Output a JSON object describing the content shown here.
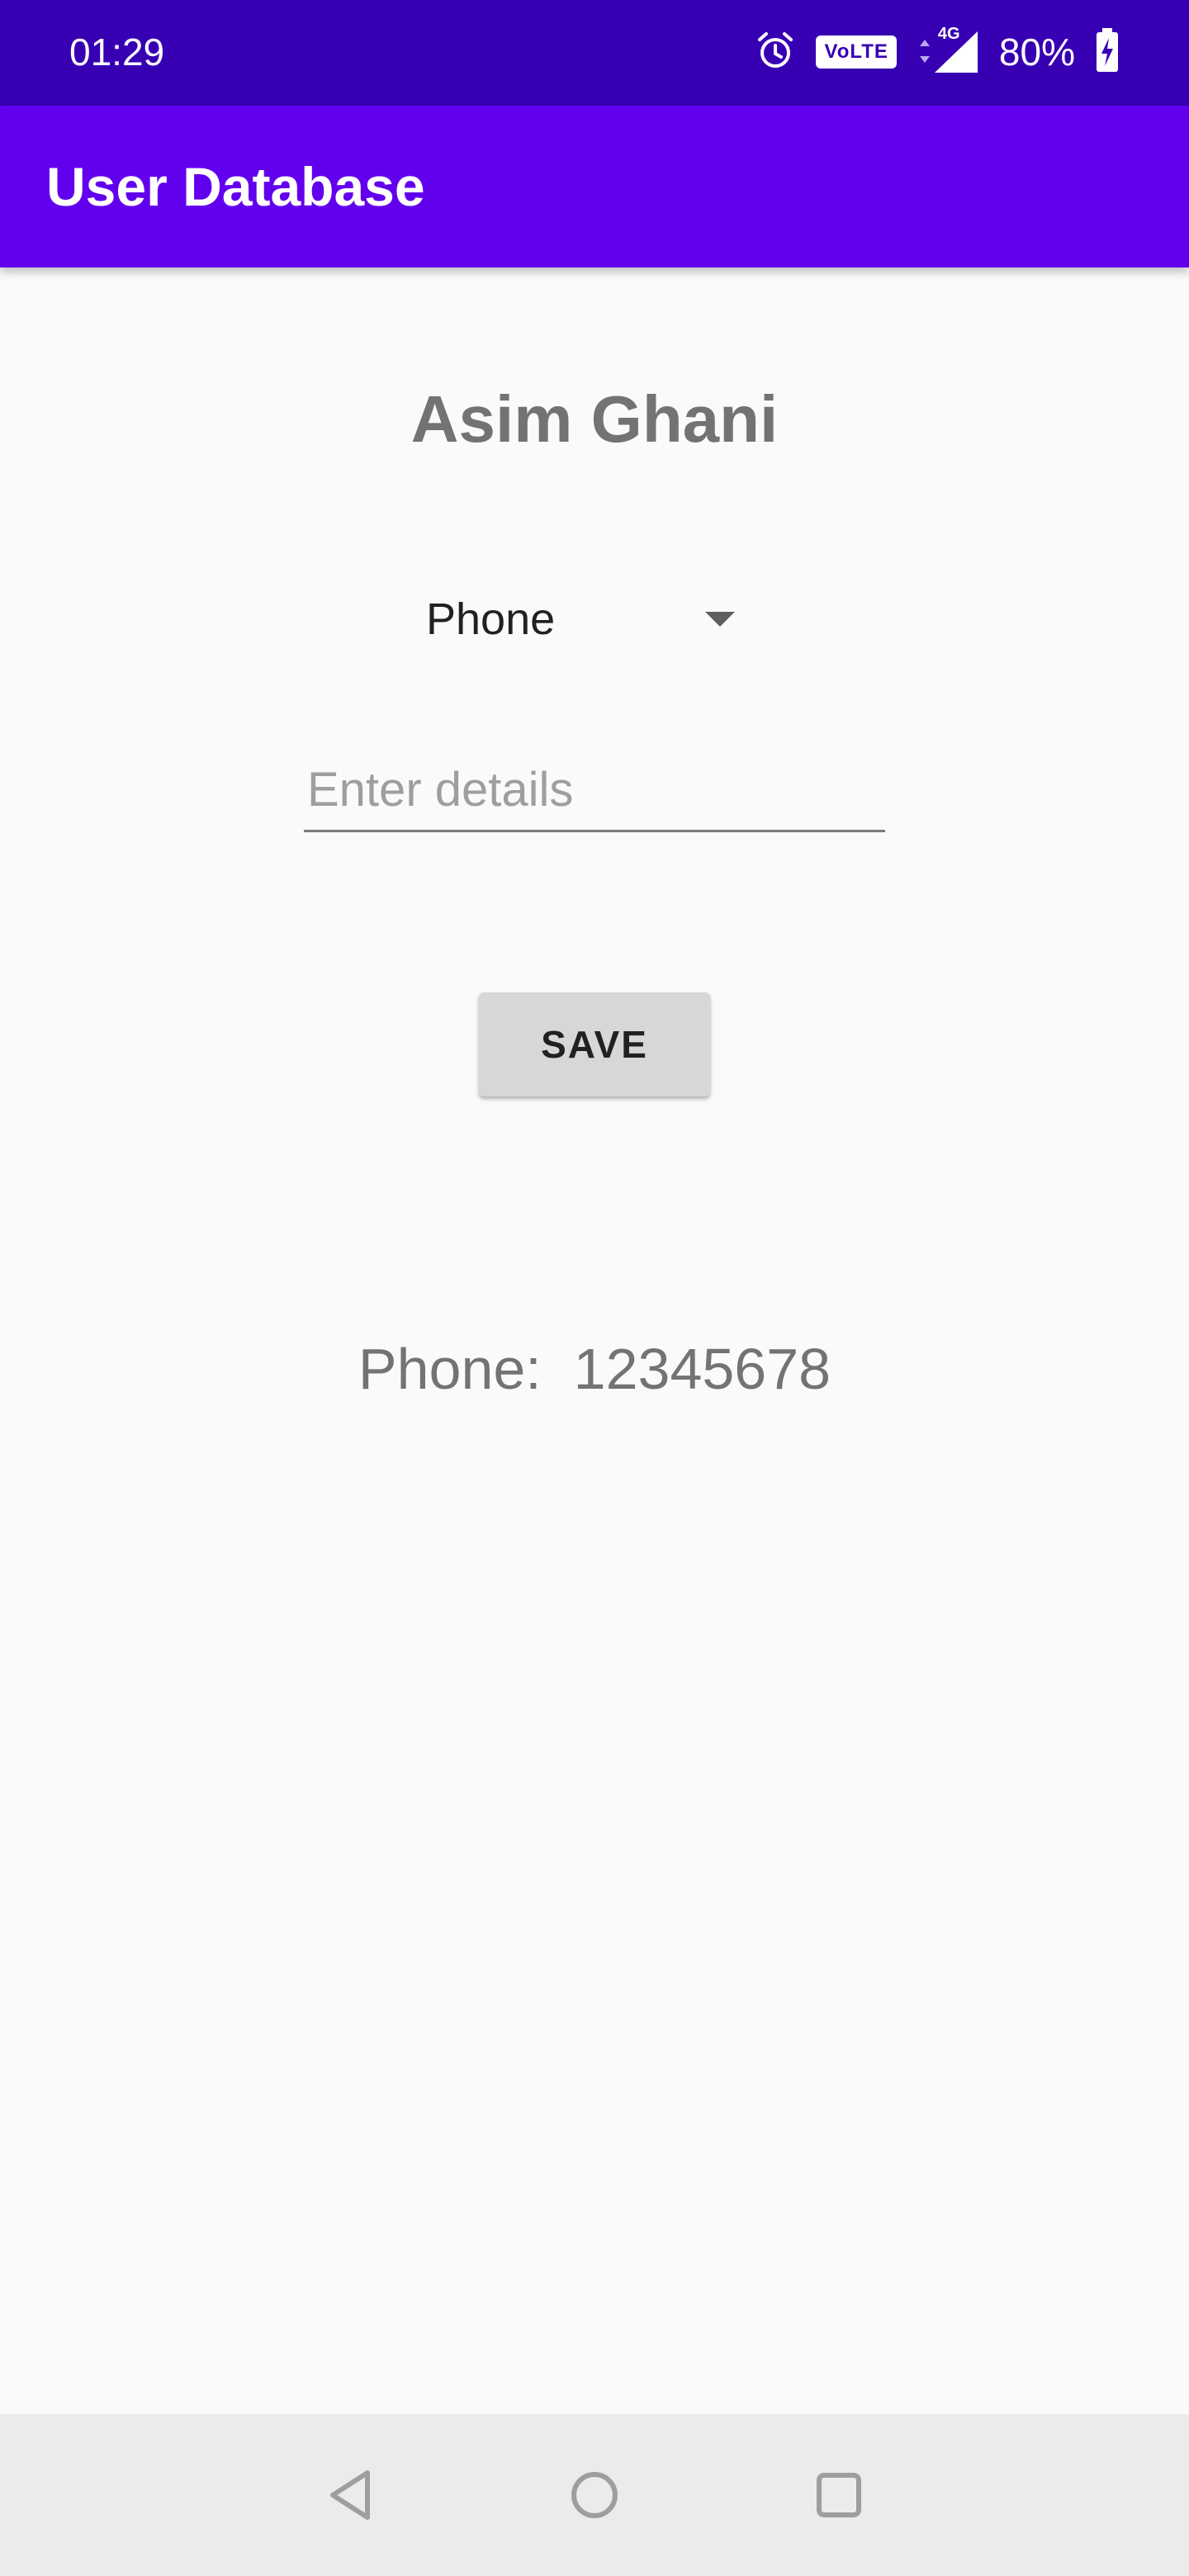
{
  "status_bar": {
    "time": "01:29",
    "icons": [
      "alarm-icon",
      "volte-badge",
      "signal-4g-icon",
      "battery-charging-icon"
    ],
    "volte_label": "VoLTE",
    "network_label": "4G",
    "battery": "80%"
  },
  "app_bar": {
    "title": "User Database"
  },
  "profile": {
    "name": "Asim Ghani"
  },
  "field_selector": {
    "selected": "Phone"
  },
  "details_input": {
    "value": "",
    "placeholder": "Enter details"
  },
  "save_button": {
    "label": "SAVE"
  },
  "result": {
    "text": "Phone:  12345678"
  },
  "nav_bar": {
    "buttons": [
      "back-icon",
      "home-icon",
      "recents-icon"
    ]
  },
  "colors": {
    "status_bar": "#3700b3",
    "app_bar": "#6200ee",
    "background": "#fafafa",
    "button": "#d6d7d7"
  }
}
